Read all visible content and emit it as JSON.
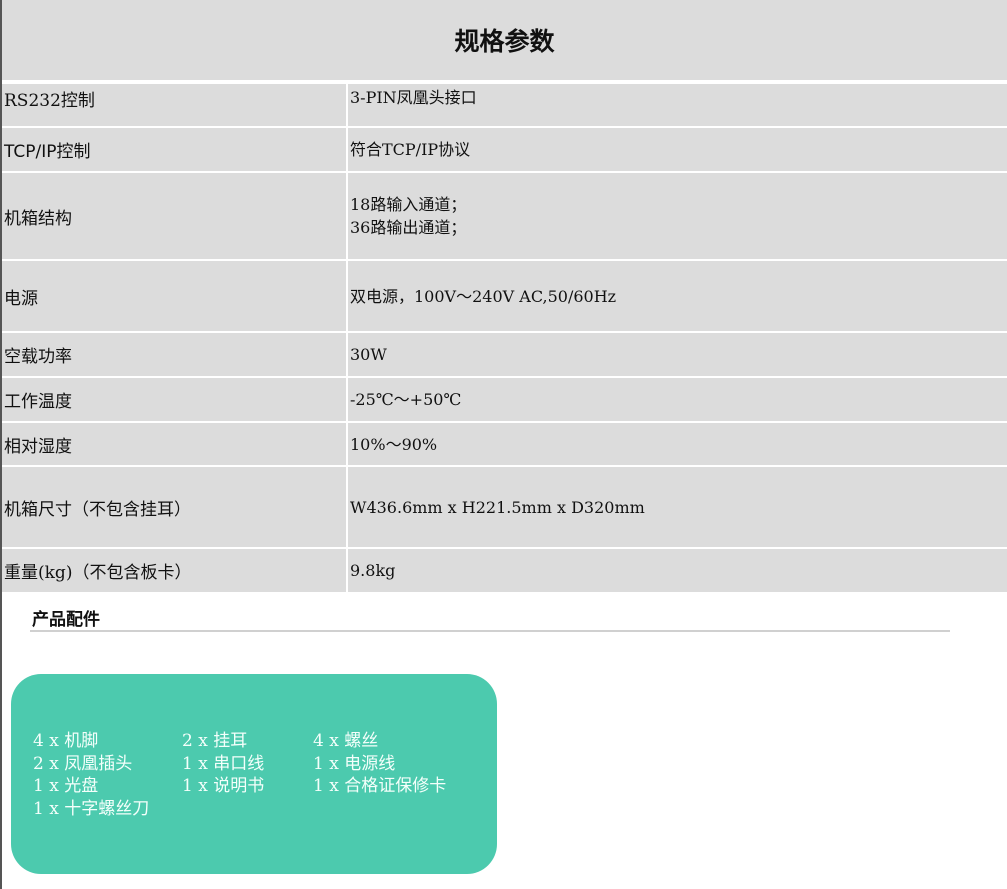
{
  "title": "规格参数",
  "specs": [
    {
      "key": "RS232控制",
      "value": "3-PIN凤凰头接口"
    },
    {
      "key": "TCP/IP控制",
      "value": "符合TCP/IP协议"
    },
    {
      "key": "机箱结构",
      "value": "18路输入通道；\n36路输出通道；"
    },
    {
      "key": "电源",
      "value": "双电源，100V～240V AC,50/60Hz"
    },
    {
      "key": "空载功率",
      "value": "30W"
    },
    {
      "key": "工作温度",
      "value": "-25℃～+50℃"
    },
    {
      "key": "相对湿度",
      "value": "10%～90%"
    },
    {
      "key": "机箱尺寸（不包含挂耳）",
      "value": "W436.6mm x H221.5mm x D320mm"
    },
    {
      "key": "重量(kg)（不包含板卡）",
      "value": "9.8kg"
    }
  ],
  "accessories_heading": "产品配件",
  "accessories": [
    "4 x 机脚",
    "2 x 挂耳",
    "4 x 螺丝",
    "2 x 凤凰插头",
    "1 x 串口线",
    "1 x 电源线",
    "1 x 光盘",
    "1 x 说明书",
    "1 x 合格证保修卡",
    "1 x 十字螺丝刀"
  ],
  "colors": {
    "table_bg": "#dcdcdc",
    "accessory_box": "#4ccaae"
  }
}
